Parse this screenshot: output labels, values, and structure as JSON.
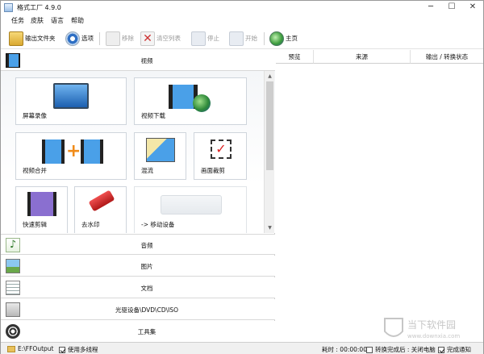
{
  "window": {
    "title": "格式工厂 4.9.0",
    "minimize": "─",
    "maximize": "☐",
    "close": "✕"
  },
  "menu": [
    "任务",
    "皮肤",
    "语言",
    "帮助"
  ],
  "toolbar": {
    "output_folder": "输出文件夹",
    "options": "选项",
    "remove": "移除",
    "clear_list": "清空列表",
    "stop": "停止",
    "start": "开始",
    "home": "主页"
  },
  "categories": {
    "video": "视频",
    "audio": "音频",
    "picture": "图片",
    "document": "文档",
    "optical": "光驱设备\\DVD\\CD\\ISO",
    "tools": "工具集"
  },
  "video_tiles": [
    "屏幕录像",
    "视频下载",
    "视频合并",
    "混流",
    "画面裁剪",
    "快速剪辑",
    "去水印",
    "-> 移动设备"
  ],
  "task_columns": [
    "预览",
    "来源",
    "输出 / 转换状态"
  ],
  "status": {
    "output_path": "E:\\FFOutput",
    "multithread": "使用多线程",
    "elapsed": "耗时 : 00:00:00",
    "after_convert": "转换完成后 : 关闭电脑",
    "notify": "完成通知"
  },
  "watermark": {
    "text": "当下软件园",
    "url": "www.downxia.com"
  },
  "colors": {
    "accent": "#2e6fc4",
    "disabled": "#9a9a9a"
  }
}
